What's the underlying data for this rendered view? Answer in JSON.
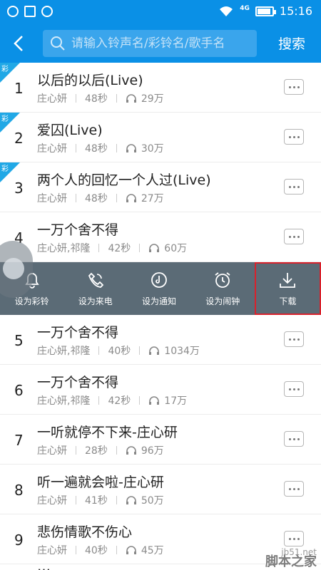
{
  "status_bar": {
    "time": "15:16",
    "network": "4G"
  },
  "header": {
    "search_placeholder": "请输入铃声名/彩铃名/歌手名",
    "search_button": "搜索"
  },
  "badge_label": "彩",
  "songs": [
    {
      "index": "1",
      "title": "以后的以后(Live)",
      "artist": "庄心妍",
      "duration": "48秒",
      "plays": "29万",
      "badge": true
    },
    {
      "index": "2",
      "title": "爱囚(Live)",
      "artist": "庄心妍",
      "duration": "48秒",
      "plays": "30万",
      "badge": true
    },
    {
      "index": "3",
      "title": "两个人的回忆一个人过(Live)",
      "artist": "庄心妍",
      "duration": "48秒",
      "plays": "27万",
      "badge": true
    },
    {
      "index": "4",
      "title": "一万个舍不得",
      "artist": "庄心妍,祁隆",
      "duration": "42秒",
      "plays": "60万",
      "badge": false
    },
    {
      "index": "5",
      "title": "一万个舍不得",
      "artist": "庄心妍,祁隆",
      "duration": "40秒",
      "plays": "1034万",
      "badge": false
    },
    {
      "index": "6",
      "title": "一万个舍不得",
      "artist": "庄心妍,祁隆",
      "duration": "42秒",
      "plays": "17万",
      "badge": false
    },
    {
      "index": "7",
      "title": "一听就停不下来-庄心研",
      "artist": "庄心妍",
      "duration": "28秒",
      "plays": "96万",
      "badge": false
    },
    {
      "index": "8",
      "title": "听一遍就会啦-庄心研",
      "artist": "庄心妍",
      "duration": "41秒",
      "plays": "50万",
      "badge": false
    },
    {
      "index": "9",
      "title": "悲伤情歌不伤心",
      "artist": "庄心妍",
      "duration": "40秒",
      "plays": "45万",
      "badge": false
    }
  ],
  "actions": [
    {
      "label": "设为彩铃",
      "icon": "bell-icon"
    },
    {
      "label": "设为来电",
      "icon": "phone-ring-icon"
    },
    {
      "label": "设为通知",
      "icon": "notification-icon"
    },
    {
      "label": "设为闹钟",
      "icon": "alarm-clock-icon"
    },
    {
      "label": "下载",
      "icon": "download-icon",
      "selected": true
    }
  ],
  "watermark": {
    "site": "jb51.net",
    "name": "脚本之家"
  }
}
